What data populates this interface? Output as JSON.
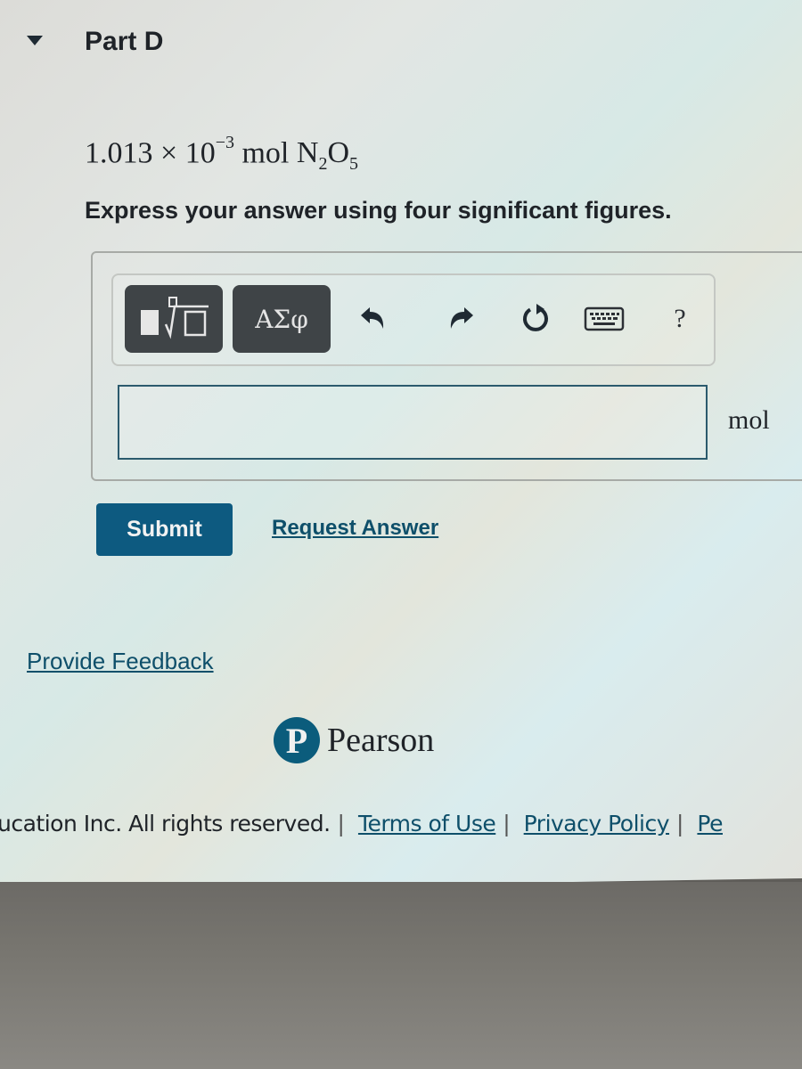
{
  "part": {
    "title": "Part D",
    "expanded": true
  },
  "question": {
    "coefficient": "1.013",
    "times": "×",
    "base": "10",
    "exponent": "−3",
    "unit": "mol",
    "species_N": "N",
    "species_N_sub": "2",
    "species_O": "O",
    "species_O_sub": "5",
    "instruction": "Express your answer using four significant figures."
  },
  "toolbar": {
    "greek_label": "ΑΣφ",
    "help_label": "?",
    "icons": [
      "templates-icon",
      "greek-letters-icon",
      "undo-icon",
      "redo-icon",
      "reset-icon",
      "keyboard-icon",
      "help-icon"
    ]
  },
  "answer": {
    "value": "",
    "unit": "mol"
  },
  "actions": {
    "submit_label": "Submit",
    "request_answer_label": "Request Answer",
    "feedback_label": "Provide Feedback"
  },
  "brand": {
    "logo_letter": "P",
    "name": "Pearson",
    "color": "#0b5c7c"
  },
  "footer": {
    "copyright": "ucation Inc. All rights reserved.",
    "links": [
      "Terms of Use",
      "Privacy Policy",
      "Pe"
    ]
  },
  "colors": {
    "accent": "#0d5a80",
    "link": "#0e4f6a",
    "toolbar_button": "#3f4447"
  }
}
